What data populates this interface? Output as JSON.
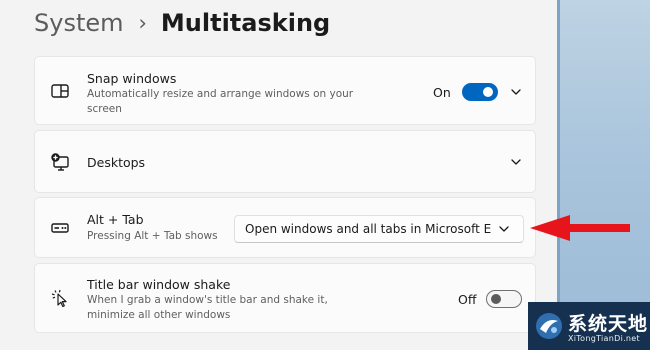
{
  "breadcrumb": {
    "parent": "System",
    "separator": "›",
    "current": "Multitasking"
  },
  "snap": {
    "title": "Snap windows",
    "description": "Automatically resize and arrange windows on your screen",
    "toggle_label": "On",
    "toggle_state": "on"
  },
  "desktops": {
    "title": "Desktops"
  },
  "alttab": {
    "title": "Alt + Tab",
    "description": "Pressing Alt + Tab shows",
    "dropdown_value": "Open windows and all tabs in Microsoft Edge"
  },
  "shake": {
    "title": "Title bar window shake",
    "description": "When I grab a window's title bar and shake it, minimize all other windows",
    "toggle_label": "Off",
    "toggle_state": "off"
  },
  "watermark": {
    "text_cn": "系统天地",
    "text_en": "XiTongTianDi.net"
  },
  "colors": {
    "accent": "#0067c0",
    "annotation_arrow": "#e8141c"
  },
  "icons": [
    "snap-layout-icon",
    "chevron-down-icon",
    "desktops-icon",
    "alt-tab-icon",
    "window-shake-icon",
    "red-arrow-annotation"
  ]
}
